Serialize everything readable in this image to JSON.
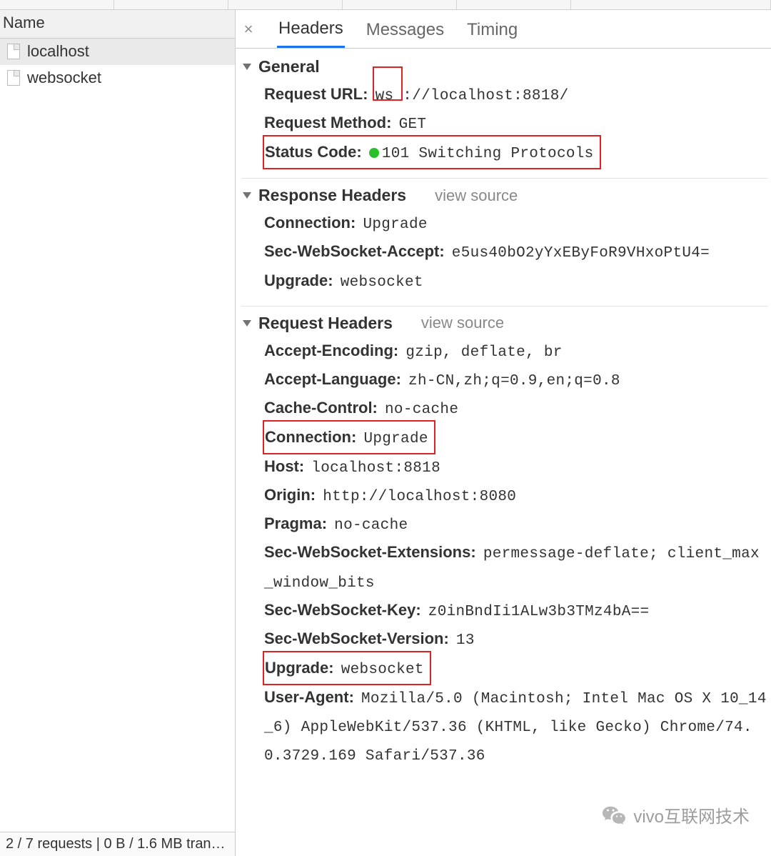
{
  "sidebar": {
    "header": "Name",
    "items": [
      {
        "label": "localhost",
        "selected": true
      },
      {
        "label": "websocket",
        "selected": false
      }
    ]
  },
  "status_bar": "2 / 7 requests | 0 B / 1.6 MB tran…",
  "tabs": {
    "headers": "Headers",
    "messages": "Messages",
    "timing": "Timing"
  },
  "active_tab": "headers",
  "sections": {
    "general": {
      "title": "General",
      "items": {
        "request_url": {
          "k": "Request URL:",
          "prefix": "ws",
          "suffix": "://localhost:8818/"
        },
        "request_method": {
          "k": "Request Method:",
          "v": "GET"
        },
        "status_code": {
          "k": "Status Code:",
          "v": "101 Switching Protocols"
        }
      }
    },
    "response_headers": {
      "title": "Response Headers",
      "view_source": "view source",
      "items": {
        "connection": {
          "k": "Connection:",
          "v": "Upgrade"
        },
        "sec_ws_accept": {
          "k": "Sec-WebSocket-Accept:",
          "v": "e5us40bO2yYxEByFoR9VHxoPtU4="
        },
        "upgrade": {
          "k": "Upgrade:",
          "v": "websocket"
        }
      }
    },
    "request_headers": {
      "title": "Request Headers",
      "view_source": "view source",
      "items": {
        "accept_encoding": {
          "k": "Accept-Encoding:",
          "v": "gzip, deflate, br"
        },
        "accept_language": {
          "k": "Accept-Language:",
          "v": "zh-CN,zh;q=0.9,en;q=0.8"
        },
        "cache_control": {
          "k": "Cache-Control:",
          "v": "no-cache"
        },
        "connection": {
          "k": "Connection:",
          "v": "Upgrade"
        },
        "host": {
          "k": "Host:",
          "v": "localhost:8818"
        },
        "origin": {
          "k": "Origin:",
          "v": "http://localhost:8080"
        },
        "pragma": {
          "k": "Pragma:",
          "v": "no-cache"
        },
        "sec_ws_ext": {
          "k": "Sec-WebSocket-Extensions:",
          "v": "permessage-deflate; client_max_window_bits"
        },
        "sec_ws_key": {
          "k": "Sec-WebSocket-Key:",
          "v": "z0inBndIi1ALw3b3TMz4bA=="
        },
        "sec_ws_ver": {
          "k": "Sec-WebSocket-Version:",
          "v": "13"
        },
        "upgrade": {
          "k": "Upgrade:",
          "v": "websocket"
        },
        "user_agent": {
          "k": "User-Agent:",
          "v": "Mozilla/5.0 (Macintosh; Intel Mac OS X 10_14_6) AppleWebKit/537.36 (KHTML, like Gecko) Chrome/74.0.3729.169 Safari/537.36"
        }
      }
    }
  },
  "watermark": "vivo互联网技术"
}
